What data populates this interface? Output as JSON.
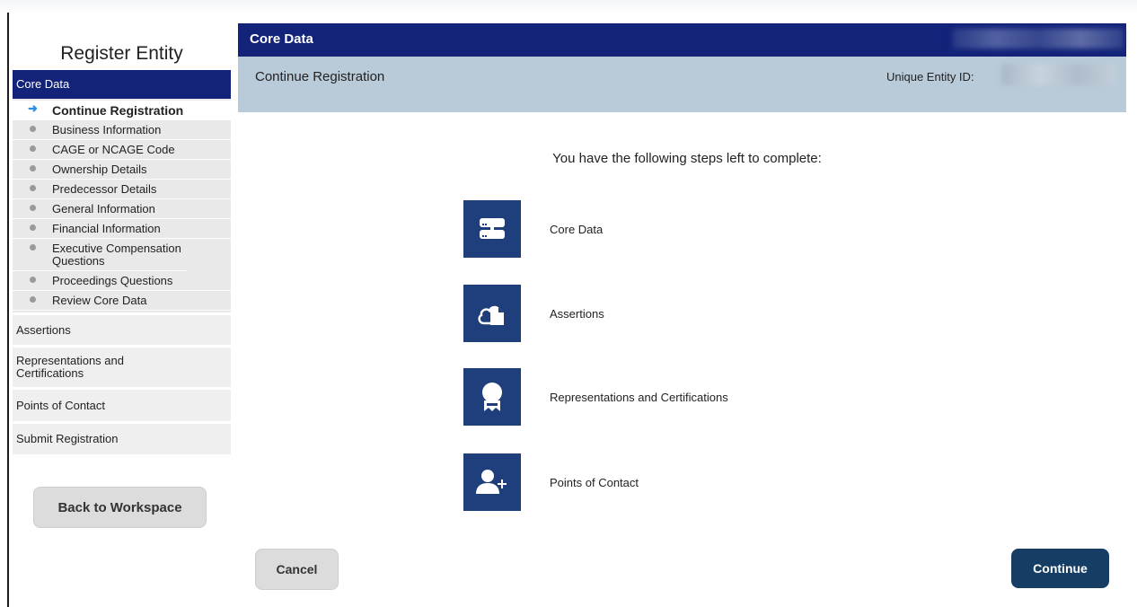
{
  "sidebar": {
    "title": "Register Entity",
    "active_section": "Core Data",
    "steps": [
      {
        "label": "Continue Registration",
        "current": true
      },
      {
        "label": "Business Information"
      },
      {
        "label": "CAGE or NCAGE Code"
      },
      {
        "label": "Ownership Details"
      },
      {
        "label": "Predecessor Details"
      },
      {
        "label": "General Information"
      },
      {
        "label": "Financial Information"
      },
      {
        "label": "Executive Compensation Questions"
      },
      {
        "label": "Proceedings Questions"
      },
      {
        "label": "Review Core Data"
      }
    ],
    "sections": [
      "Assertions",
      "Representations and Certifications",
      "Points of Contact",
      "Submit Registration"
    ],
    "back_button": "Back to Workspace"
  },
  "header": {
    "title": "Core Data"
  },
  "subheader": {
    "title": "Continue Registration",
    "uei_label": "Unique Entity ID:"
  },
  "main": {
    "intro": "You have the following steps left to complete:",
    "tasks": [
      {
        "label": "Core Data",
        "icon": "server-icon"
      },
      {
        "label": "Assertions",
        "icon": "cloud-document-icon"
      },
      {
        "label": "Representations and Certifications",
        "icon": "award-ribbon-icon"
      },
      {
        "label": "Points of Contact",
        "icon": "user-add-icon"
      }
    ]
  },
  "footer": {
    "cancel": "Cancel",
    "continue": "Continue"
  },
  "colors": {
    "navy": "#13237a",
    "tile": "#1e3f7c",
    "subheader": "#b9cad9",
    "continue_button": "#163d63",
    "arrow": "#2b8fe6"
  }
}
